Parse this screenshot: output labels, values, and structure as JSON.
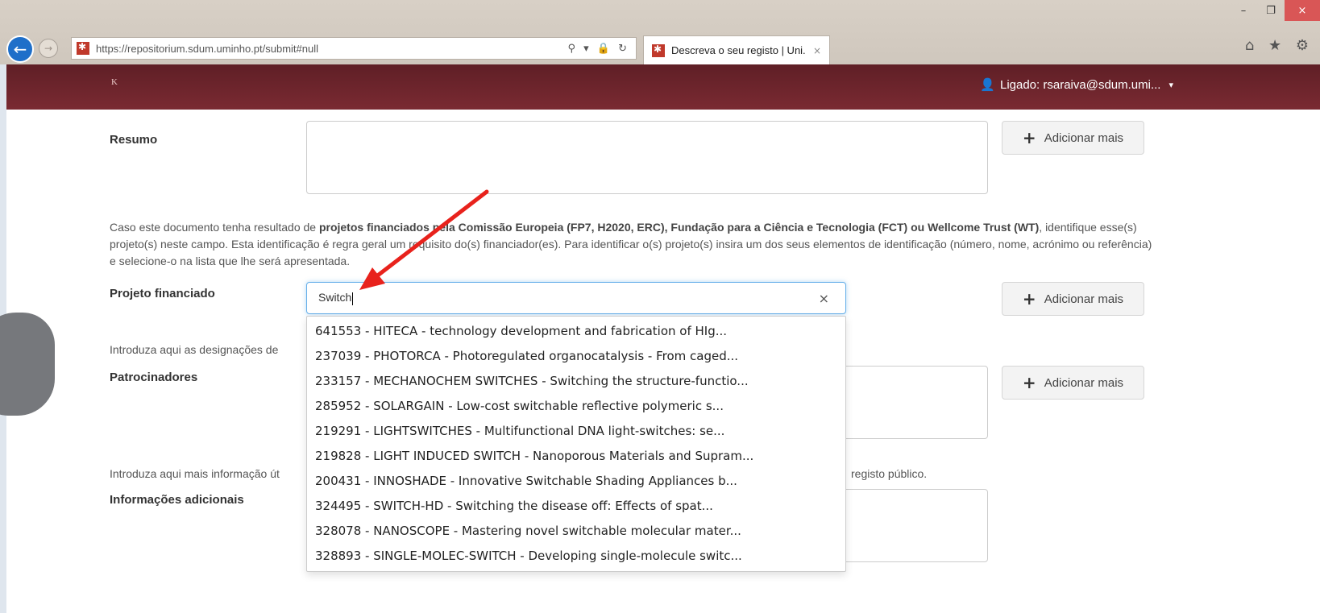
{
  "browser": {
    "url": "https://repositorium.sdum.uminho.pt/submit#null",
    "url_tools": "⚲ ▾ 🔒 ↻",
    "tab_title": "Descreva o seu registo | Uni...",
    "tab_close": "×",
    "window_controls": [
      "–",
      "❐",
      "×"
    ],
    "toolbar_icons": "⌂ ★ ⚙"
  },
  "header": {
    "logo_text": "K",
    "user_label": "Ligado: rsaraiva@sdum.umi...",
    "caret": "▾"
  },
  "form": {
    "resumo_label": "Resumo",
    "add_more_label": "Adicionar mais",
    "project_help": "identifique esse(s) projeto(s) neste campo. Esta identificação é regra geral um requisito do(s) financiador(es). Para identificar o(s) projeto(s) insira um dos seus elementos de identificação (número, nome, acrónimo ou referência) e selecione-o na lista que lhe será apresentada.",
    "project_help_start": "Caso este documento tenha resultado de ",
    "project_help_bold": "projetos financiados pela Comissão Europeia (FP7, H2020, ERC), Fundação para a Ciência e Tecnologia (FCT) ou Wellcome Trust (WT)",
    "project_label": "Projeto financiado",
    "project_value": "Switch",
    "clear_icon": "×",
    "sponsors_help": "Introduza aqui as designações de",
    "sponsors_label": "Patrocinadores",
    "info_help_start": "Introduza aqui mais informação út",
    "info_help_end": "registo público.",
    "info_label": "Informações adicionais"
  },
  "suggestions": [
    "641553 - HITECA - technology development and fabrication of HIg...",
    "237039 - PHOTORCA - Photoregulated organocatalysis - From caged...",
    "233157 - MECHANOCHEM SWITCHES - Switching the structure-functio...",
    "285952 - SOLARGAIN - Low-cost switchable reflective polymeric s...",
    "219291 - LIGHTSWITCHES - Multifunctional DNA light-switches: se...",
    "219828 - LIGHT INDUCED SWITCH - Nanoporous Materials and Supram...",
    "200431 - INNOSHADE - Innovative Switchable Shading Appliances b...",
    "324495 - SWITCH-HD - Switching the disease off: Effects of spat...",
    "328078 - NANOSCOPE - Mastering novel switchable molecular mater...",
    "328893 - SINGLE-MOLEC-SWITCH - Developing single-molecule switc..."
  ],
  "colors": {
    "header_bg": "#6b252c",
    "accent_arrow": "#e8221c",
    "focus_border": "#66afe9"
  }
}
